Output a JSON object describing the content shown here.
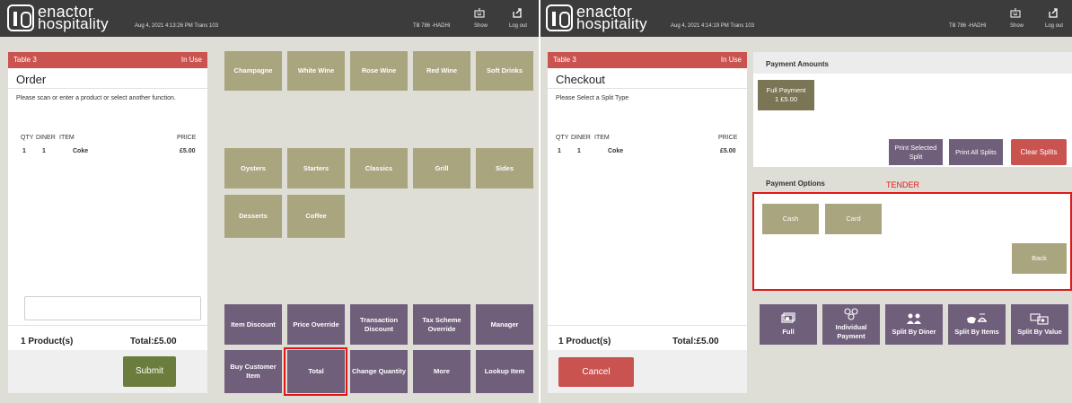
{
  "brand": {
    "line1": "enactor",
    "line2": "hospitality"
  },
  "left": {
    "timestamp": "Aug 4, 2021 4:13:26 PM  Trans 103",
    "till": "Till 786 -HADHI",
    "show_label": "Show",
    "logout_label": "Log out",
    "table_label": "Table 3",
    "status": "In Use",
    "title": "Order",
    "instruction": "Please scan or enter a product or select another function.",
    "columns": {
      "qty": "QTY",
      "diner": "DINER",
      "item": "ITEM",
      "price": "PRICE"
    },
    "rows": [
      {
        "qty": "1",
        "diner": "1",
        "item": "Coke",
        "price": "£5.00"
      }
    ],
    "products": "1 Product(s)",
    "total": "Total:£5.00",
    "submit_label": "Submit"
  },
  "menu": {
    "row1": [
      "Champagne",
      "White Wine",
      "Rose Wine",
      "Red Wine",
      "Soft Drinks"
    ],
    "row2": [
      "Oysters",
      "Starters",
      "Classics",
      "Grill",
      "Sides"
    ],
    "row3": [
      "Desserts",
      "Coffee"
    ],
    "func1": [
      "Item Discount",
      "Price Override",
      "Transaction Discount",
      "Tax Scheme Override",
      "Manager"
    ],
    "func2": [
      "Buy Customer Item",
      "Total",
      "Change Quantity",
      "More",
      "Lookup Item"
    ]
  },
  "right": {
    "timestamp": "Aug 4, 2021 4:14:19 PM  Trans 103",
    "till": "Till 786 -HADHI",
    "show_label": "Show",
    "logout_label": "Log out",
    "table_label": "Table 3",
    "status": "In Use",
    "title": "Checkout",
    "instruction": "Please Select a Split Type",
    "columns": {
      "qty": "QTY",
      "diner": "DINER",
      "item": "ITEM",
      "price": "PRICE"
    },
    "rows": [
      {
        "qty": "1",
        "diner": "1",
        "item": "Coke",
        "price": "£5.00"
      }
    ],
    "products": "1 Product(s)",
    "total": "Total:£5.00",
    "cancel_label": "Cancel"
  },
  "payment": {
    "amounts_heading": "Payment Amounts",
    "full_payment_line1": "Full Payment",
    "full_payment_line2": "1 £5.00",
    "print_selected": "Print Selected Split",
    "print_all": "Print All Splits",
    "clear_splits": "Clear Splits",
    "options_heading": "Payment Options",
    "tender_annotation": "TENDER",
    "cash": "Cash",
    "card": "Card",
    "back": "Back",
    "split_types": [
      "Full",
      "Individual Payment",
      "Split By Diner",
      "Split By Items",
      "Split By Value"
    ]
  },
  "colors": {
    "annotation": "#e01818",
    "header_red": "#c9534f",
    "tan": "#a9a57e",
    "purple": "#6f5f7b",
    "submit_green": "#6a7d3d"
  },
  "icons": [
    "keyboard-icon",
    "logout-icon",
    "full-payment-icon",
    "individual-payment-icon",
    "split-by-diner-icon",
    "split-by-items-icon",
    "split-by-value-icon"
  ]
}
